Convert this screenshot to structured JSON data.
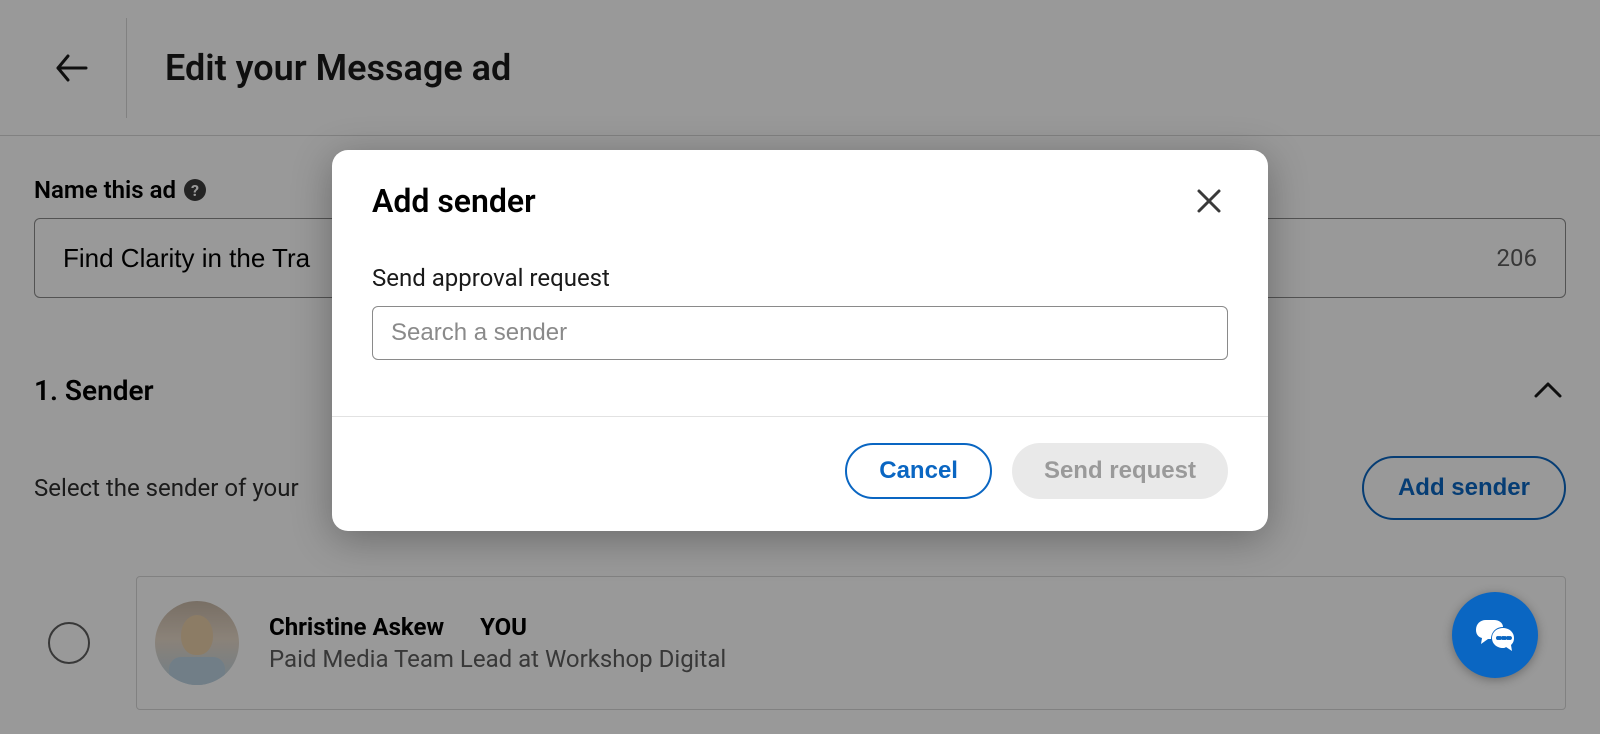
{
  "header": {
    "title": "Edit your Message ad"
  },
  "name_field": {
    "label": "Name this ad",
    "value": "Find Clarity in the Tra",
    "char_remaining": "206"
  },
  "sender_section": {
    "title": "1.   Sender",
    "help_text": "Select the sender of your",
    "add_button": "Add sender",
    "item": {
      "name": "Christine Askew",
      "you_badge": "YOU",
      "role": "Paid Media Team Lead at Workshop Digital"
    }
  },
  "modal": {
    "title": "Add sender",
    "approval_label": "Send approval request",
    "search_placeholder": "Search a sender",
    "cancel": "Cancel",
    "send_request": "Send request"
  }
}
